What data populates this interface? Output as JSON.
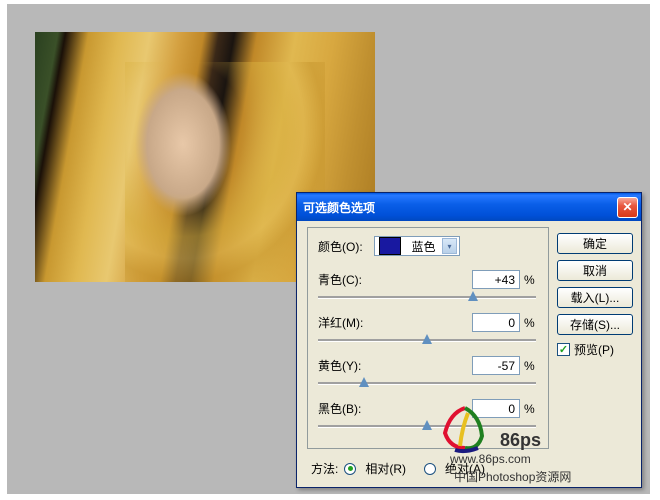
{
  "dialog": {
    "title": "可选颜色选项",
    "fieldset_label": "颜色(O):",
    "color_dropdown": {
      "selected": "蓝色",
      "swatch_color": "#1818a0"
    },
    "sliders": [
      {
        "label": "青色(C):",
        "value": "+43",
        "unit": "%",
        "thumb_pct": 71
      },
      {
        "label": "洋红(M):",
        "value": "0",
        "unit": "%",
        "thumb_pct": 50
      },
      {
        "label": "黄色(Y):",
        "value": "-57",
        "unit": "%",
        "thumb_pct": 21
      },
      {
        "label": "黑色(B):",
        "value": "0",
        "unit": "%",
        "thumb_pct": 50
      }
    ],
    "buttons": {
      "ok": "确定",
      "cancel": "取消",
      "load": "载入(L)...",
      "save": "存储(S)..."
    },
    "preview": {
      "label": "预览(P)",
      "checked": true
    },
    "method": {
      "label": "方法:",
      "relative": "相对(R)",
      "absolute": "绝对(A)",
      "selected": "relative"
    }
  },
  "watermark": {
    "brand": "86ps",
    "url": "www.86ps.com",
    "desc": "中国Photoshop资源网"
  }
}
